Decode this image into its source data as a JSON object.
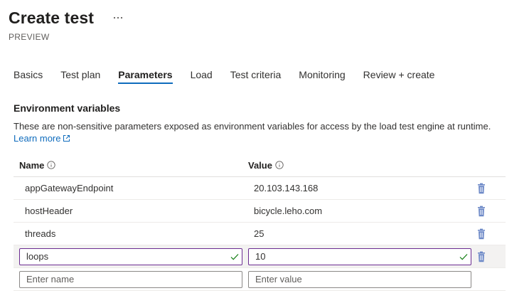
{
  "header": {
    "title": "Create test",
    "more_label": "···",
    "subtitle": "PREVIEW"
  },
  "tabs": [
    {
      "label": "Basics",
      "active": false
    },
    {
      "label": "Test plan",
      "active": false
    },
    {
      "label": "Parameters",
      "active": true
    },
    {
      "label": "Load",
      "active": false
    },
    {
      "label": "Test criteria",
      "active": false
    },
    {
      "label": "Monitoring",
      "active": false
    },
    {
      "label": "Review + create",
      "active": false
    }
  ],
  "env_section": {
    "title": "Environment variables",
    "description": "These are non-sensitive parameters exposed as environment variables for access by the load test engine at runtime.",
    "learn_more": "Learn more"
  },
  "grid": {
    "columns": {
      "name": "Name",
      "value": "Value"
    },
    "rows": [
      {
        "name": "appGatewayEndpoint",
        "value": "20.103.143.168"
      },
      {
        "name": "hostHeader",
        "value": "bicycle.leho.com"
      },
      {
        "name": "threads",
        "value": "25"
      }
    ],
    "editing_row": {
      "name": "loops",
      "value": "10"
    },
    "new_row": {
      "name_placeholder": "Enter name",
      "value_placeholder": "Enter value"
    }
  },
  "colors": {
    "accent": "#0f6cbd",
    "edited_border": "#6b2c91",
    "trash_icon": "#6d89c7"
  },
  "icons": {
    "more": "more-horizontal-icon",
    "info": "info-icon",
    "external": "external-link-icon",
    "delete": "trash-icon",
    "valid": "checkmark-icon"
  }
}
